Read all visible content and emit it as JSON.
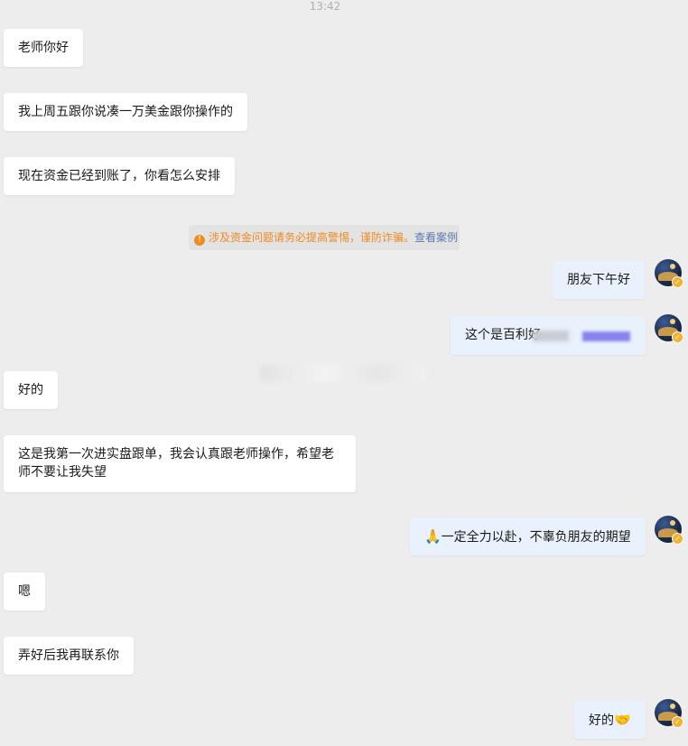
{
  "timestamp": "13:42",
  "notice": {
    "message": "涉及资金问题请务必提高警惕，谨防诈骗。",
    "link": "查看案例"
  },
  "messages": [
    {
      "side": "left",
      "text": "老师你好"
    },
    {
      "side": "left",
      "text": "我上周五跟你说凑一万美金跟你操作的"
    },
    {
      "side": "left",
      "text": "现在资金已经到账了，你看怎么安排"
    },
    {
      "side": "right",
      "text": "朋友下午好"
    },
    {
      "side": "right",
      "text": "这个是百利好"
    },
    {
      "side": "left",
      "text": "好的"
    },
    {
      "side": "left",
      "text": "这是我第一次进实盘跟单，我会认真跟老师操作，希望老师不要让我失望"
    },
    {
      "side": "right",
      "emoji": "🙏",
      "text": "一定全力以赴，不辜负朋友的期望"
    },
    {
      "side": "left",
      "text": "嗯"
    },
    {
      "side": "left",
      "text": "弄好后我再联系你"
    },
    {
      "side": "right",
      "text": "好的",
      "emoji": "🤝"
    }
  ],
  "colors": {
    "background": "#ededed",
    "incoming_bubble": "#ffffff",
    "outgoing_bubble": "#e8f1fc",
    "warning": "#f08b1d",
    "link": "#5b7bb0",
    "badge": "#f2b233"
  },
  "icons": {
    "warning": "warning-circle-icon",
    "avatar_badge": "verified-badge-icon"
  }
}
